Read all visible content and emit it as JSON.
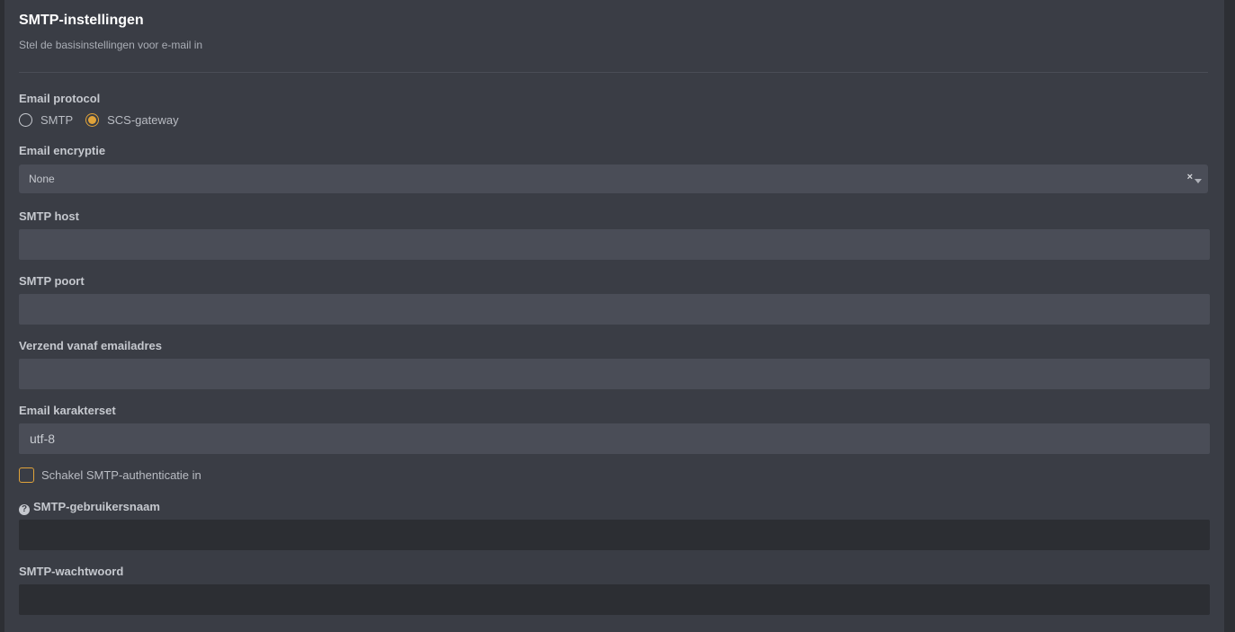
{
  "section": {
    "title": "SMTP-instellingen",
    "subtitle": "Stel de basisinstellingen voor e-mail in"
  },
  "protocol": {
    "label": "Email protocol",
    "options": [
      "SMTP",
      "SCS-gateway"
    ],
    "selected": "SCS-gateway"
  },
  "encryption": {
    "label": "Email encryptie",
    "value": "None",
    "clear_symbol": "×"
  },
  "smtp_host": {
    "label": "SMTP host",
    "value": ""
  },
  "smtp_port": {
    "label": "SMTP poort",
    "value": ""
  },
  "from_address": {
    "label": "Verzend vanaf emailadres",
    "value": ""
  },
  "charset": {
    "label": "Email karakterset",
    "value": "utf-8"
  },
  "auth": {
    "label": "Schakel SMTP-authenticatie in",
    "checked": false
  },
  "username": {
    "label": "SMTP-gebruikersnaam",
    "help_icon": "question-circle-icon",
    "value": ""
  },
  "password": {
    "label": "SMTP-wachtwoord",
    "value": ""
  },
  "colors": {
    "accent": "#e0a33a",
    "panel": "#3a3d45",
    "input": "#4a4d57",
    "input_disabled": "#2c2e33"
  }
}
